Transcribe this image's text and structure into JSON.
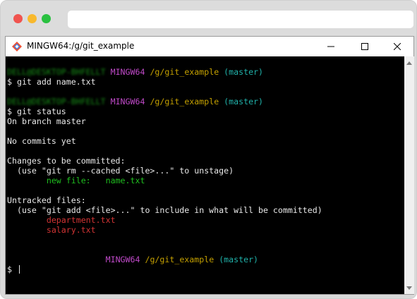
{
  "window": {
    "title": "MINGW64:/g/git_example",
    "icon": "git-bash-icon"
  },
  "terminal": {
    "prompts": [
      {
        "user_host": "DELL@DESKTOP-BHFELLT",
        "env": "MINGW64",
        "path": "/g/git_example",
        "branch": "(master)"
      },
      {
        "user_host": "DELL@DESKTOP-BHFELLT",
        "env": "MINGW64",
        "path": "/g/git_example",
        "branch": "(master)"
      },
      {
        "user_host": "",
        "env": "MINGW64",
        "path": "/g/git_example",
        "branch": "(master)"
      }
    ],
    "cmd1": "$ git add name.txt",
    "cmd2": "$ git status",
    "on_branch": "On branch master",
    "no_commits": "No commits yet",
    "changes_header": "Changes to be committed:",
    "changes_hint": "  (use \"git rm --cached <file>...\" to unstage)",
    "new_file_label": "        new file:   ",
    "new_file_name": "name.txt",
    "untracked_header": "Untracked files:",
    "untracked_hint": "  (use \"git add <file>...\" to include in what will be committed)",
    "untracked_files": [
      "department.txt",
      "salary.txt"
    ],
    "final_prompt": "$ ",
    "colors": {
      "user_host": "#1fbf1f",
      "env": "#c04ac9",
      "path": "#c4a000",
      "branch": "#20b2aa",
      "staged": "#1fbf1f",
      "untracked": "#d23434"
    }
  }
}
